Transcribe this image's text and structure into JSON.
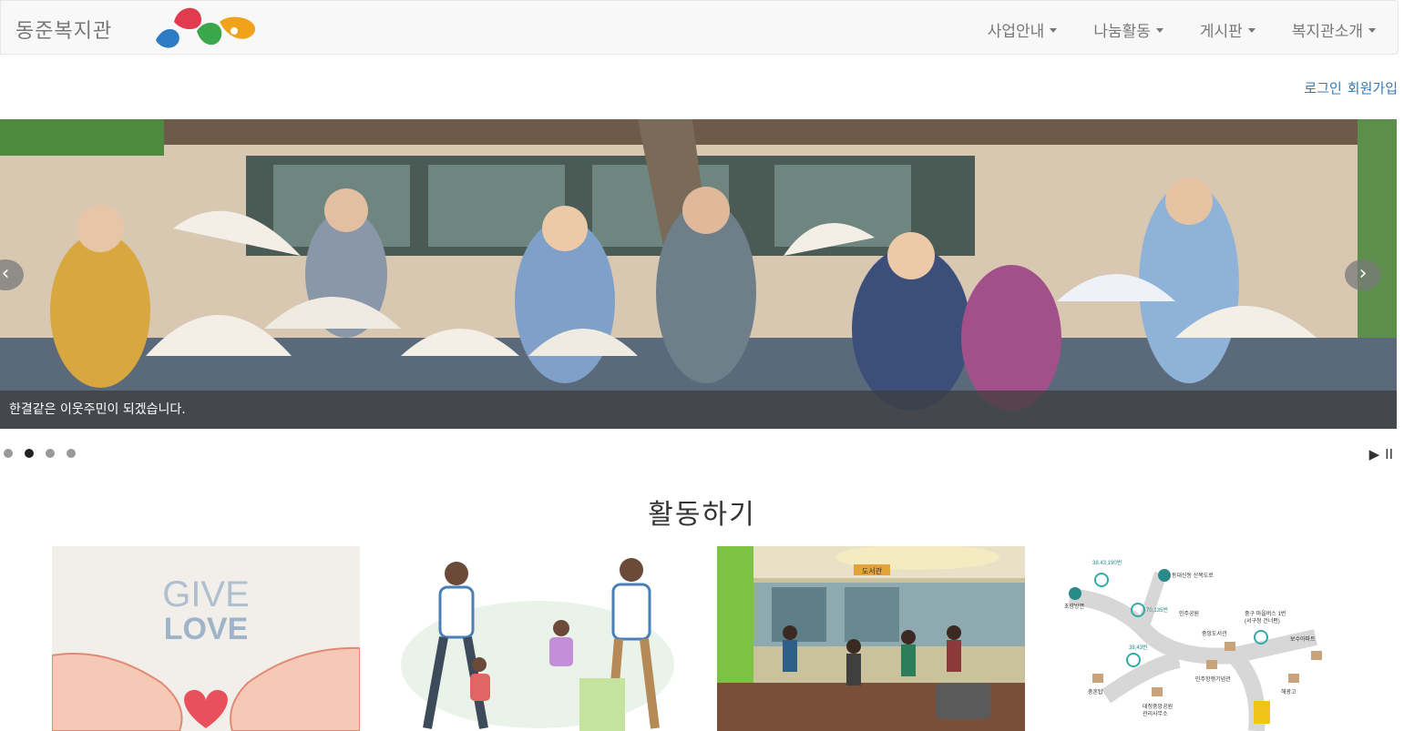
{
  "header": {
    "brand": "동준복지관",
    "menu": [
      {
        "label": "사업안내"
      },
      {
        "label": "나눔활동"
      },
      {
        "label": "게시판"
      },
      {
        "label": "복지관소개"
      }
    ]
  },
  "auth": {
    "login": "로그인",
    "signup": "회원가입"
  },
  "carousel": {
    "caption": "한결같은 이웃주민이 되겠습니다.",
    "prev": "‹",
    "next": "›",
    "slide_count": 4,
    "active_index": 1,
    "play": "▶",
    "pause": "II"
  },
  "activity": {
    "title": "활동하기",
    "cards": [
      {
        "line1": "GIVE",
        "line2": "LOVE"
      },
      {},
      {
        "sign": "도서관"
      },
      {
        "labels": [
          "38,43,190번",
          "동대신동 산복도로",
          "초량방면",
          "70,135번",
          "민주공원",
          "중구 마을버스 1번",
          "(서구청 건너편)",
          "중앙도서관",
          "38,43번",
          "보수아파트",
          "민주항쟁기념관",
          "충혼탑",
          "대청중앙공원",
          "관리사무소",
          "해광고"
        ]
      }
    ]
  },
  "colors": {
    "link": "#337ab7",
    "nav_text": "#777777",
    "caption_bg": "#3c3c3c"
  }
}
